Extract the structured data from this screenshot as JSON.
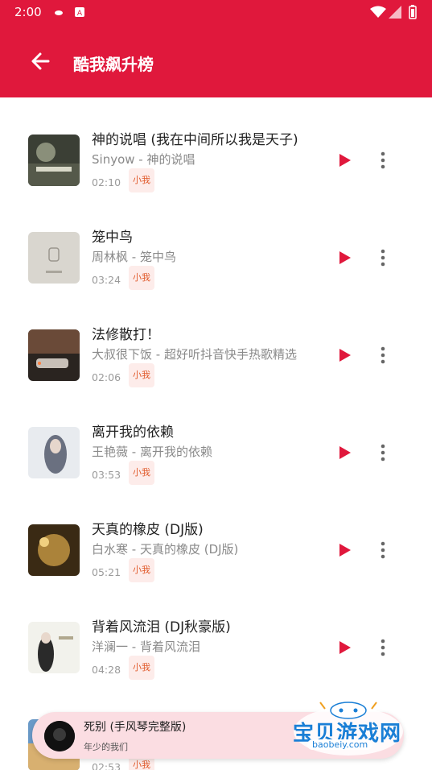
{
  "status_bar": {
    "time": "2:00"
  },
  "app_bar": {
    "title": "酷我飙升榜"
  },
  "songs": [
    {
      "title": "神的说唱 (我在中间所以我是天子)",
      "subtitle": "Sinyow - 神的说唱",
      "duration": "02:10",
      "badge": "小我"
    },
    {
      "title": "笼中鸟",
      "subtitle": "周林枫 - 笼中鸟",
      "duration": "03:24",
      "badge": "小我"
    },
    {
      "title": "法修散打！",
      "subtitle": "大叔很下饭 - 超好听抖音快手热歌精选",
      "duration": "02:06",
      "badge": "小我"
    },
    {
      "title": "离开我的依赖",
      "subtitle": "王艳薇 - 离开我的依赖",
      "duration": "03:53",
      "badge": "小我"
    },
    {
      "title": "天真的橡皮 (DJ版)",
      "subtitle": "白水寒 - 天真的橡皮 (DJ版)",
      "duration": "05:21",
      "badge": "小我"
    },
    {
      "title": "背着风流泪 (DJ秋豪版)",
      "subtitle": "洋澜一 - 背着风流泪",
      "duration": "04:28",
      "badge": "小我"
    },
    {
      "title": "",
      "subtitle": "",
      "duration": "02:53",
      "badge": "小我"
    }
  ],
  "mini_player": {
    "title": "死别 (手风琴完整版)",
    "subtitle": "年少的我们"
  },
  "watermark": {
    "text": "宝贝游戏网",
    "url": "baobeiy.com"
  },
  "colors": {
    "accent": "#e0183c",
    "badge_bg": "#fdecea",
    "badge_text": "#e05a2b",
    "mini_bg": "#fbdde2"
  }
}
